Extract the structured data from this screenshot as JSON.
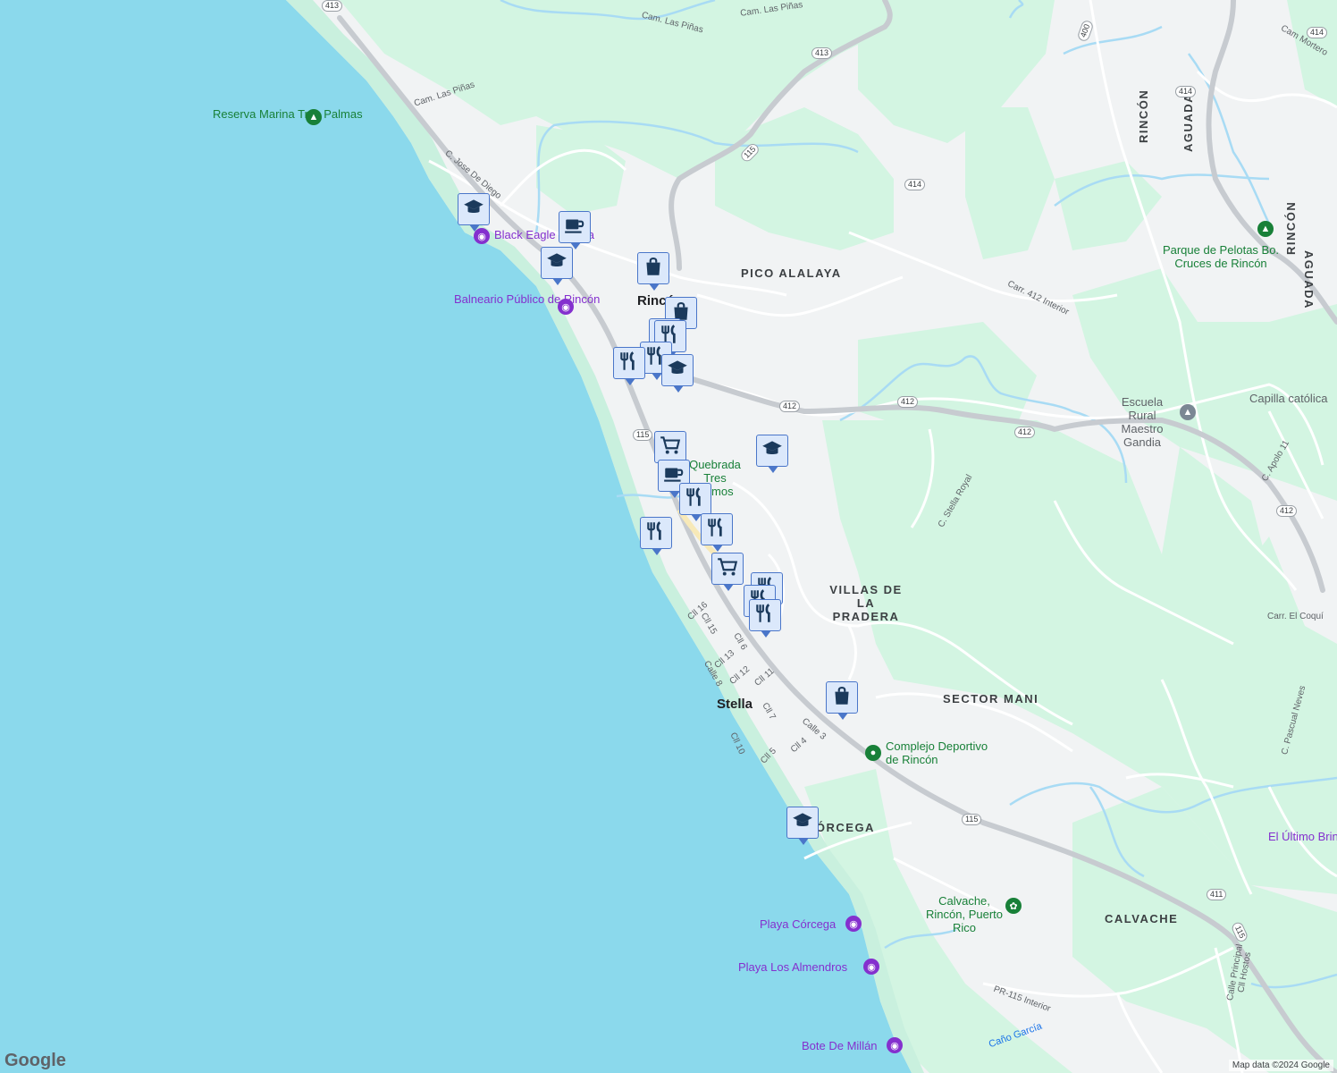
{
  "map": {
    "colors": {
      "water": "#8bd9ec",
      "land": "#f1f3f4",
      "park": "#d3f5e2",
      "beach": "#c9f0de",
      "road": "#ffffff",
      "highway": "#c7cbd0",
      "river": "#a8dbf4"
    },
    "area_labels": [
      "PICO ALALAYA",
      "VILLAS DE LA PRADERA",
      "SECTOR MANI",
      "CALVACHE",
      "CÓRCEGA",
      "RINCÓN",
      "AGUADA",
      "RINCÓN",
      "AGUADA"
    ],
    "town_labels": [
      "Rincón",
      "Stella"
    ],
    "street_labels": [
      "Cam. Las Piñas",
      "Cam. Las Piñas",
      "Cam. Las Piñas",
      "C. Jose De Diego",
      "Carr. 412 Interior",
      "C. Stella Royal",
      "C. Apolo 11",
      "Carr. El Coquí",
      "C. Pascual Neves",
      "Cam Mortero",
      "Cll 16",
      "Cll 15",
      "Cll 13",
      "Cll 12",
      "Cll 11",
      "Cll 6",
      "Calle 8",
      "Cll 7",
      "Calle 3",
      "Cll 4",
      "Cll 5",
      "Cll 10",
      "PR-115 Interior",
      "Calle Principal",
      "Cll Hostos",
      "Caño García",
      "Quebrada Tres Ramos"
    ],
    "route_shields": [
      "413",
      "413",
      "115",
      "414",
      "414",
      "414",
      "412",
      "412",
      "412",
      "412",
      "115",
      "115",
      "115",
      "411",
      "400"
    ],
    "pois": [
      {
        "name": "Reserva Marina Tres Palmas",
        "type": "park",
        "icon": "tree-icon"
      },
      {
        "name": "Black Eagle Marina",
        "type": "attraction",
        "icon": "camera-icon"
      },
      {
        "name": "Balneario Público de Rincón",
        "type": "attraction",
        "icon": "camera-icon"
      },
      {
        "name": "Parque de Pelotas Bo. Cruces de Rincón",
        "type": "park",
        "icon": "tree-icon"
      },
      {
        "name": "Escuela Rural Maestro Gandia",
        "type": "school",
        "icon": "school-icon"
      },
      {
        "name": "Capilla católica",
        "type": "church",
        "icon": ""
      },
      {
        "name": "Complejo Deportivo de Rincón",
        "type": "park",
        "icon": "sports-icon"
      },
      {
        "name": "Calvache, Rincón, Puerto Rico",
        "type": "park",
        "icon": "flower-icon"
      },
      {
        "name": "Playa Córcega",
        "type": "attraction",
        "icon": "camera-icon"
      },
      {
        "name": "Playa Los Almendros",
        "type": "attraction",
        "icon": "camera-icon"
      },
      {
        "name": "Bote De Millán",
        "type": "attraction",
        "icon": "camera-icon"
      },
      {
        "name": "El Último Brinco",
        "type": "attraction",
        "icon": ""
      }
    ],
    "markers": [
      "school-icon",
      "coffee-icon",
      "school-icon",
      "bag-icon",
      "bag-icon",
      "restaurant-icon",
      "restaurant-icon",
      "restaurant-icon",
      "restaurant-icon",
      "school-icon",
      "cart-icon",
      "school-icon",
      "coffee-icon",
      "restaurant-icon",
      "restaurant-icon",
      "restaurant-icon",
      "restaurant-icon",
      "cart-icon",
      "restaurant-icon",
      "restaurant-icon",
      "bag-icon",
      "school-icon"
    ],
    "attribution": "Map data ©2024 Google",
    "logo": "Google"
  }
}
